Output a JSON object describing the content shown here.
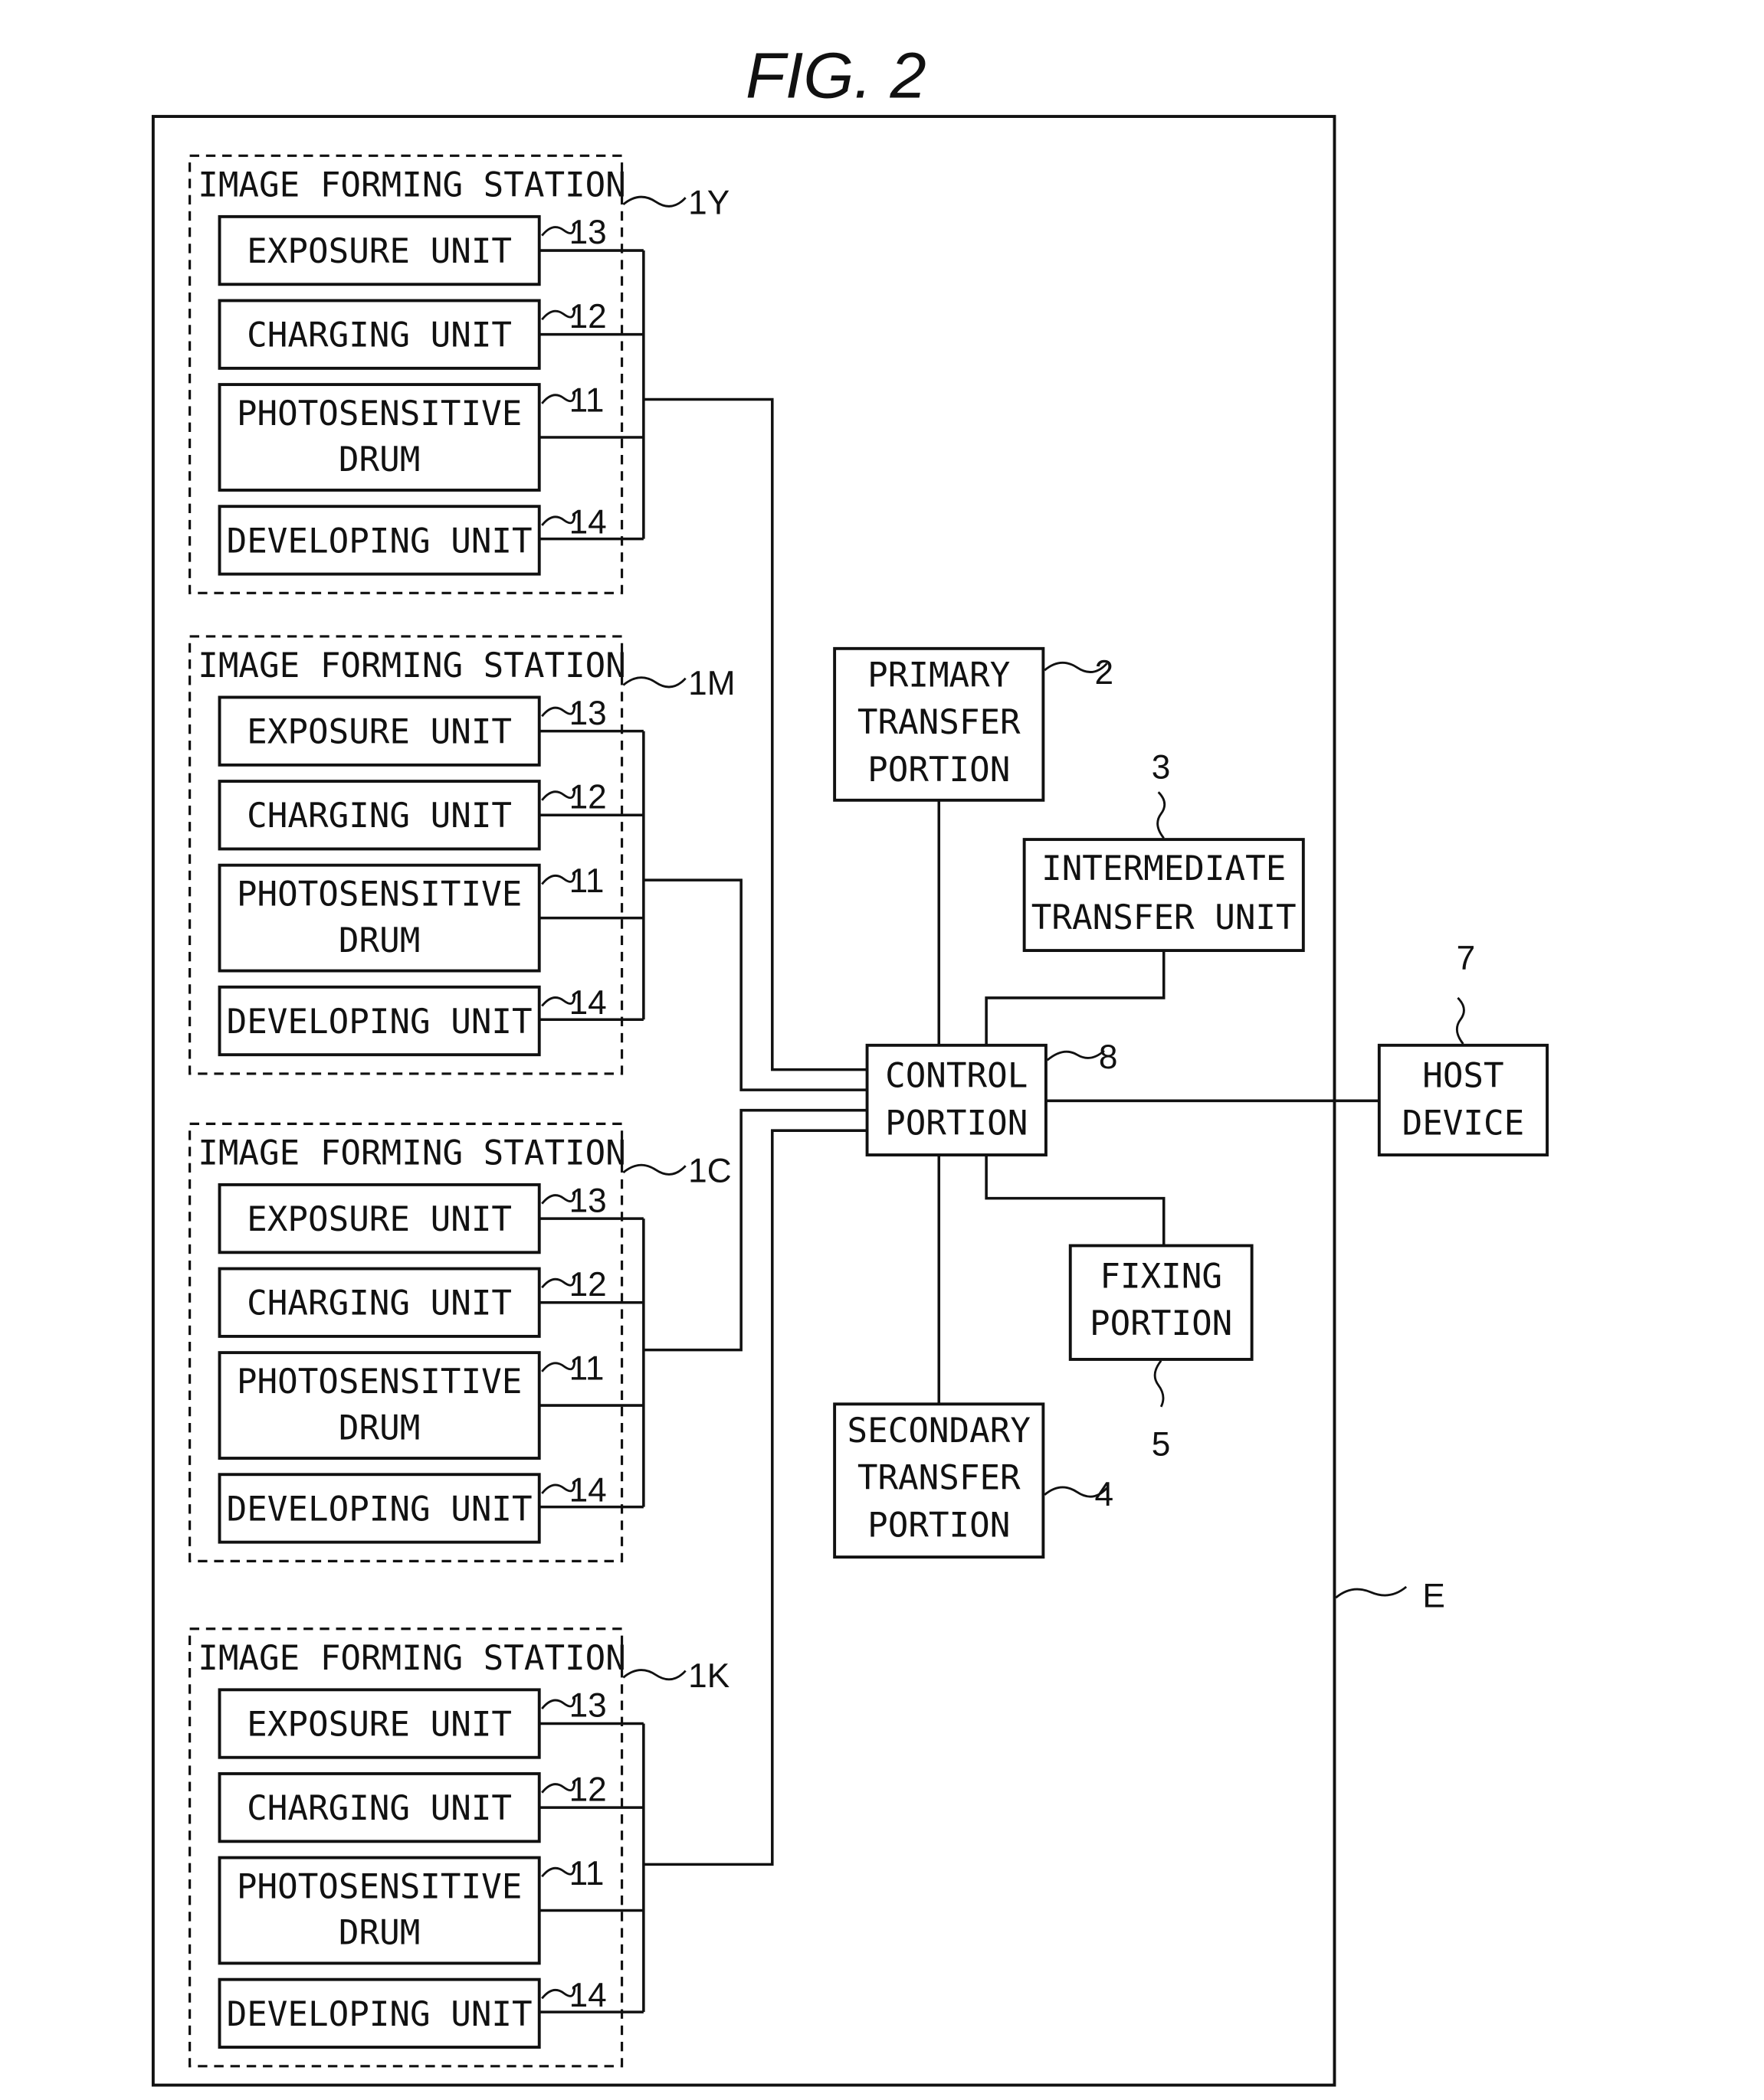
{
  "title": "FIG. 2",
  "apparatus_label": "E",
  "stations": [
    {
      "header": "IMAGE FORMING STATION",
      "ref": "1Y"
    },
    {
      "header": "IMAGE FORMING STATION",
      "ref": "1M"
    },
    {
      "header": "IMAGE FORMING STATION",
      "ref": "1C"
    },
    {
      "header": "IMAGE FORMING STATION",
      "ref": "1K"
    }
  ],
  "units": {
    "exposure": {
      "line1": "EXPOSURE UNIT",
      "ref": "13"
    },
    "charging": {
      "line1": "CHARGING UNIT",
      "ref": "12"
    },
    "drum": {
      "line1": "PHOTOSENSITIVE",
      "line2": "DRUM",
      "ref": "11"
    },
    "developing": {
      "line1": "DEVELOPING UNIT",
      "ref": "14"
    }
  },
  "primary_transfer": {
    "line1": "PRIMARY",
    "line2": "TRANSFER",
    "line3": "PORTION",
    "ref": "2"
  },
  "intermediate_transfer": {
    "line1": "INTERMEDIATE",
    "line2": "TRANSFER UNIT",
    "ref": "3"
  },
  "control": {
    "line1": "CONTROL",
    "line2": "PORTION",
    "ref": "8"
  },
  "fixing": {
    "line1": "FIXING",
    "line2": "PORTION",
    "ref": "5"
  },
  "secondary_transfer": {
    "line1": "SECONDARY",
    "line2": "TRANSFER",
    "line3": "PORTION",
    "ref": "4"
  },
  "host": {
    "line1": "HOST",
    "line2": "DEVICE",
    "ref": "7"
  }
}
